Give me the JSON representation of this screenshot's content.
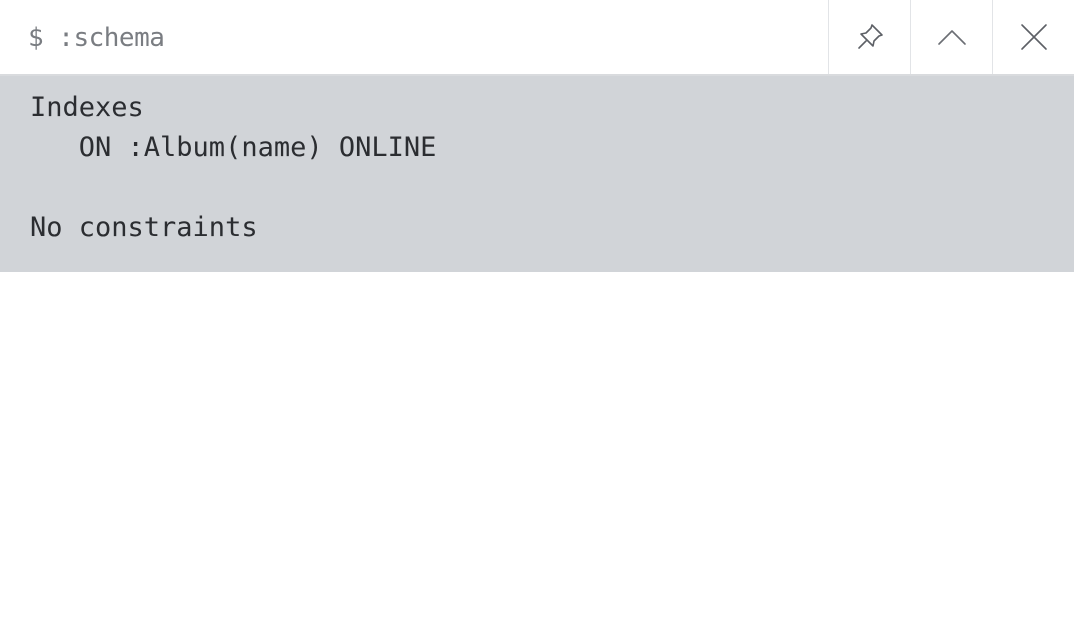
{
  "header": {
    "command": "$ :schema",
    "actions": [
      {
        "name": "pin-icon"
      },
      {
        "name": "collapse-chevron-up-icon"
      },
      {
        "name": "close-icon"
      }
    ]
  },
  "result": {
    "lines": [
      "Indexes",
      "   ON :Album(name) ONLINE",
      "",
      "No constraints"
    ]
  },
  "colors": {
    "header_bg": "#ffffff",
    "result_bg": "#d1d4d8",
    "text": "#2b2d31",
    "command_text": "#7a7d82",
    "border": "#d9dbde"
  }
}
